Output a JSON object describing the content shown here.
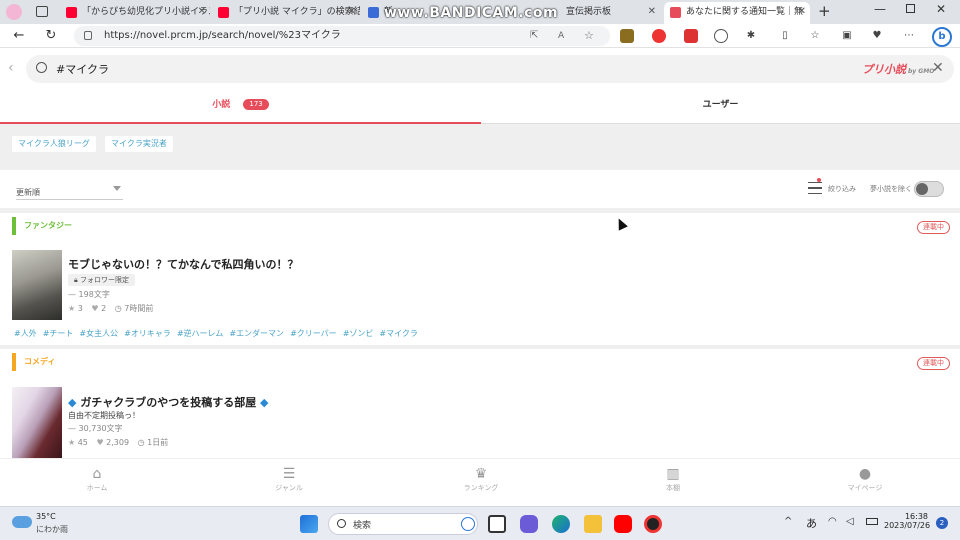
{
  "browser": {
    "tabs": [
      {
        "title": "",
        "active": false
      },
      {
        "title": "",
        "active": false
      },
      {
        "title": "「からぴち幼児化プリ小説イラス",
        "active": false
      },
      {
        "title": "「プリ小説 マイクラ」の検索結果",
        "active": false
      },
      {
        "title": "新",
        "active": false
      },
      {
        "title": "宣伝掲示板",
        "active": false
      },
      {
        "title": "あなたに関する通知一覧｜無",
        "active": true
      }
    ],
    "url": "https://novel.prcm.jp/search/novel/%23マイクラ",
    "watermark": "www.BANDICAM.com"
  },
  "search": {
    "query": "#マイクラ",
    "logo": "プリ小説",
    "logo_suffix": "by GMO"
  },
  "tabs": {
    "novels": "小説",
    "novels_count": "173",
    "users": "ユーザー"
  },
  "related_tags": [
    "マイクラ人狼リーグ",
    "マイクラ実況者"
  ],
  "sort": {
    "selected": "更新順",
    "filter_label": "絞り込み",
    "toggle_label": "夢小説を除く"
  },
  "cards": [
    {
      "genre": "ファンタジー",
      "status": "連載中",
      "title": "モブじゃないの！？てかなんで私四角いの！？",
      "follower_only": "フォロワー限定",
      "chars": "198文字",
      "stars": "3",
      "hearts": "2",
      "updated": "7時間前",
      "hashtags": [
        "#人外",
        "#チート",
        "#女主人公",
        "#オリキャラ",
        "#逆ハーレム",
        "#エンダーマン",
        "#クリーパー",
        "#ゾンビ",
        "#マイクラ"
      ]
    },
    {
      "genre": "コメディ",
      "status": "連載中",
      "title": "ガチャクラブのやつを投稿する部屋",
      "description": "自由不定期投稿っ！",
      "chars": "30,730文字",
      "stars": "45",
      "hearts": "2,309",
      "updated": "1日前"
    }
  ],
  "bottom_nav": [
    "ホーム",
    "ジャンル",
    "ランキング",
    "本棚",
    "マイページ"
  ],
  "taskbar": {
    "weather_temp": "35°C",
    "weather_desc": "にわか雨",
    "search_placeholder": "検索",
    "ime": "あ",
    "time": "16:38",
    "date": "2023/07/26",
    "notifications": "2"
  },
  "colors": {
    "accent": "#e74c5a",
    "fantasy": "#6dbf3a",
    "comedy": "#f5a623",
    "tag": "#4aa3c8"
  }
}
